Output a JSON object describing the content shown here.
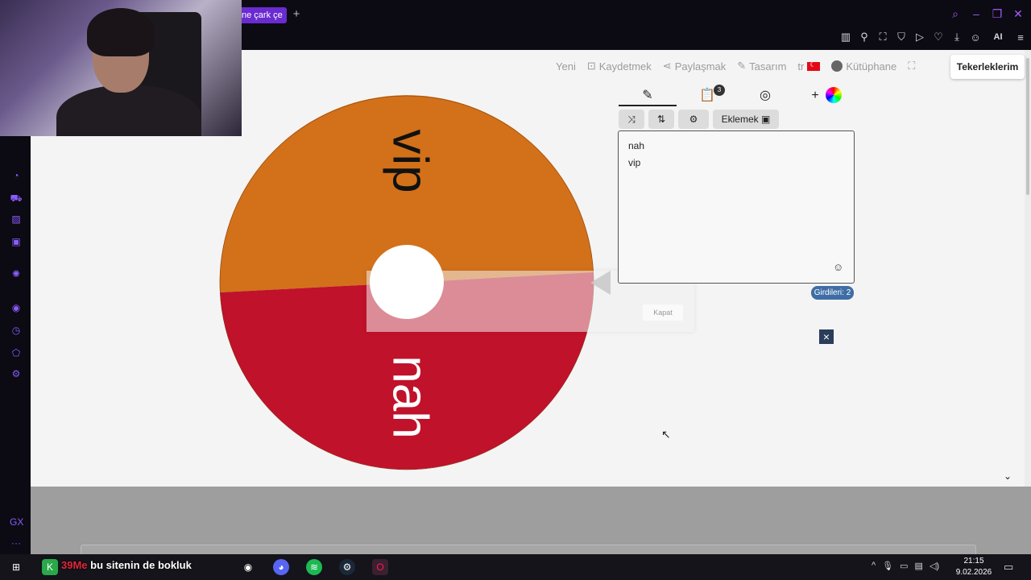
{
  "browser": {
    "tab_title": "ne çark çe",
    "new_tab_symbol": "+",
    "toolbar_ai_label": "AI"
  },
  "site_nav": {
    "new_label": "Yeni",
    "save_label": "Kaydetmek",
    "share_label": "Paylaşmak",
    "design_label": "Tasarım",
    "language_label": "tr",
    "library_label": "Kütüphane",
    "my_wheels_label": "Tekerleklerim"
  },
  "wheel": {
    "segments": [
      {
        "label": "vip",
        "color": "#d2711a"
      },
      {
        "label": "nah",
        "color": "#c0122a"
      }
    ]
  },
  "editor": {
    "add_button_label": "Eklemek",
    "entries": [
      "nah",
      "vip"
    ],
    "entries_count_label": "Girdileri: 2",
    "results_badge": "3"
  },
  "popup": {
    "close_label": "Kapat"
  },
  "taskbar": {
    "ticker_number": "39",
    "ticker_red_text": "Me",
    "ticker_text": "bu sitenin de bokluk",
    "time": "21:15",
    "date": "9.02.2026"
  }
}
